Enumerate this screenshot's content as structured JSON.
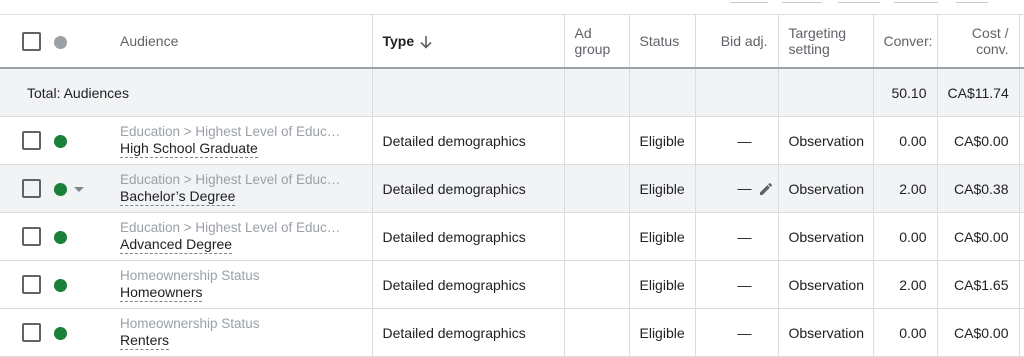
{
  "columns": {
    "audience": "Audience",
    "type": "Type",
    "ad_group": "Ad group",
    "status": "Status",
    "bid_adj": "Bid adj.",
    "targeting": "Targeting setting",
    "conversions": "Conver:",
    "cost_conv": "Cost / conv."
  },
  "sort": {
    "column": "Type",
    "direction": "descending",
    "icon": "arrow-down-icon"
  },
  "total": {
    "label": "Total: Audiences",
    "conversions": "50.10",
    "cost_conv": "CA$11.74"
  },
  "rows": [
    {
      "category": "Education > Highest Level of Educ…",
      "name": "High School Graduate",
      "type": "Detailed demographics",
      "status": "Eligible",
      "bid_adj": "—",
      "targeting": "Observation",
      "conversions": "0.00",
      "cost_conv": "CA$0.00"
    },
    {
      "category": "Education > Highest Level of Educ…",
      "name": "Bachelor’s Degree",
      "type": "Detailed demographics",
      "status": "Eligible",
      "bid_adj": "—",
      "targeting": "Observation",
      "conversions": "2.00",
      "cost_conv": "CA$0.38"
    },
    {
      "category": "Education > Highest Level of Educ…",
      "name": "Advanced Degree",
      "type": "Detailed demographics",
      "status": "Eligible",
      "bid_adj": "—",
      "targeting": "Observation",
      "conversions": "0.00",
      "cost_conv": "CA$0.00"
    },
    {
      "category": "Homeownership Status",
      "name": "Homeowners",
      "type": "Detailed demographics",
      "status": "Eligible",
      "bid_adj": "—",
      "targeting": "Observation",
      "conversions": "2.00",
      "cost_conv": "CA$1.65"
    },
    {
      "category": "Homeownership Status",
      "name": "Renters",
      "type": "Detailed demographics",
      "status": "Eligible",
      "bid_adj": "—",
      "targeting": "Observation",
      "conversions": "0.00",
      "cost_conv": "CA$0.00"
    }
  ],
  "colors": {
    "status_enabled": "#188038",
    "status_header": "#9aa0a6",
    "total_row_bg": "#f1f3f4",
    "highlight_row_bg": "#f1f3f4"
  }
}
